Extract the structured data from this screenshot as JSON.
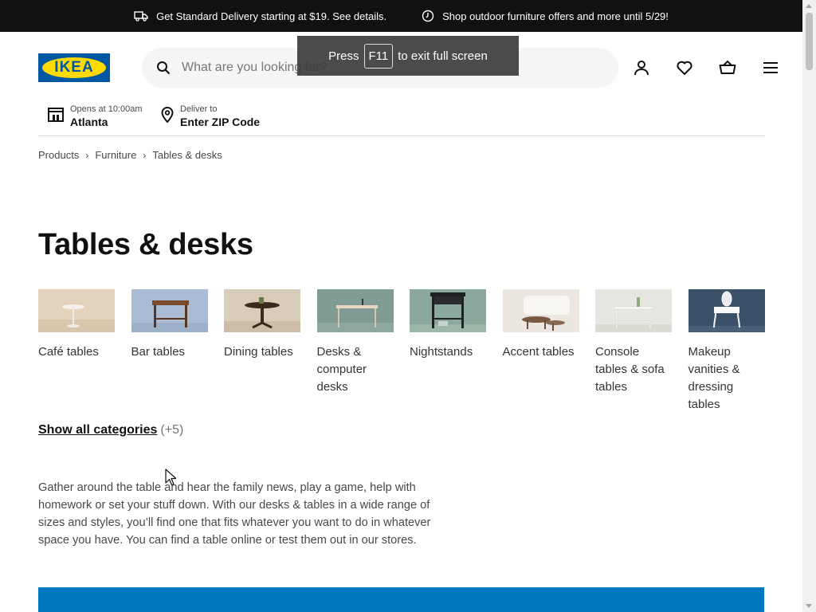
{
  "topbar": {
    "delivery_text": "Get Standard Delivery starting at $19. See details.",
    "offer_text": "Shop outdoor furniture offers and more until 5/29!"
  },
  "logo": {
    "text": "IKEA"
  },
  "search": {
    "placeholder": "What are you looking for?"
  },
  "fullscreen_toast": {
    "press": "Press",
    "key": "F11",
    "rest": "to exit full screen"
  },
  "header_icons": [
    "profile-icon",
    "heart-icon",
    "basket-icon",
    "menu-icon"
  ],
  "store": {
    "hours": "Opens at 10:00am",
    "city": "Atlanta"
  },
  "delivery": {
    "label": "Deliver to",
    "value": "Enter ZIP Code"
  },
  "breadcrumb": [
    "Products",
    "Furniture",
    "Tables & desks"
  ],
  "page_title": "Tables & desks",
  "categories": [
    {
      "label": "Café tables"
    },
    {
      "label": "Bar tables"
    },
    {
      "label": "Dining tables"
    },
    {
      "label": "Desks & computer desks"
    },
    {
      "label": "Nightstands"
    },
    {
      "label": "Accent tables"
    },
    {
      "label": "Console tables & sofa tables"
    },
    {
      "label": "Makeup vanities & dressing tables"
    }
  ],
  "show_all": {
    "label": "Show all categories",
    "count": "(+5)"
  },
  "description": "Gather around the table and hear the family news, play a game, help with homework or set your stuff down. With our desks & tables in a wide range of sizes and styles, you’ll find one that fits whatever you want to do in whatever space you have. You can find a table online or test them out in our stores.",
  "colors": {
    "brand_blue": "#0058a3",
    "brand_yellow": "#ffdb00",
    "banner_blue": "#0077c1"
  }
}
